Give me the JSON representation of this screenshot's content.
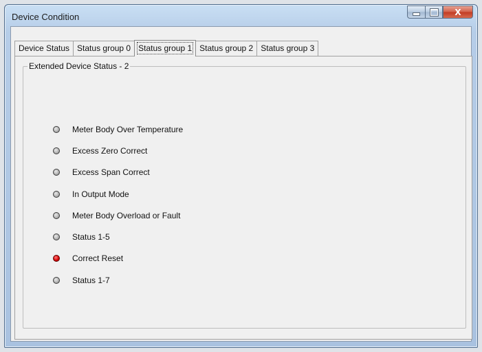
{
  "window": {
    "title": "Device Condition",
    "close_glyph": "X"
  },
  "tabs": [
    {
      "label": "Device Status"
    },
    {
      "label": "Status group 0"
    },
    {
      "label": "Status group 1",
      "active": true
    },
    {
      "label": "Status group 2"
    },
    {
      "label": "Status group 3"
    }
  ],
  "group": {
    "title": "Extended Device Status - 2"
  },
  "status_items": [
    {
      "label": "Meter Body Over Temperature",
      "state": "off"
    },
    {
      "label": "Excess Zero Correct",
      "state": "off"
    },
    {
      "label": "Excess Span Correct",
      "state": "off"
    },
    {
      "label": "In Output Mode",
      "state": "off"
    },
    {
      "label": "Meter Body Overload or Fault",
      "state": "off"
    },
    {
      "label": "Status 1-5",
      "state": "off"
    },
    {
      "label": "Correct Reset",
      "state": "on"
    },
    {
      "label": "Status 1-7",
      "state": "off"
    }
  ],
  "colors": {
    "indicator_on": "#d40000",
    "indicator_off": "#a7a7a7"
  },
  "icons": {
    "indicator": "led-indicator-icon",
    "minimize": "minimize-icon",
    "maximize": "maximize-icon",
    "close": "close-icon"
  }
}
